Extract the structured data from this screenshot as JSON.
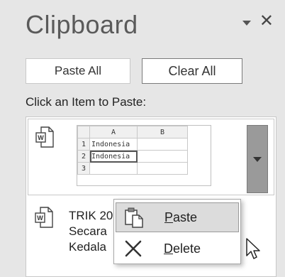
{
  "pane": {
    "title": "Clipboard",
    "options_icon": "dropdown-triangle-icon",
    "close_icon": "close-icon"
  },
  "buttons": {
    "paste_all": "Paste All",
    "clear_all": "Clear All"
  },
  "instruction": "Click an Item to Paste:",
  "items": [
    {
      "icon": "word-document-icon",
      "thumbnail": {
        "col_headers": [
          "A",
          "B"
        ],
        "rows": [
          {
            "num": "1",
            "a": "Indonesia",
            "b": ""
          },
          {
            "num": "2",
            "a": "Indonesia",
            "b": ""
          },
          {
            "num": "3",
            "a": "",
            "b": ""
          }
        ]
      },
      "dropdown_icon": "dropdown-triangle-icon"
    },
    {
      "icon": "word-document-icon",
      "text": "TRIK 20\nSecara\nKedala"
    }
  ],
  "context_menu": {
    "paste": {
      "underline": "P",
      "rest": "aste",
      "icon": "paste-icon"
    },
    "delete": {
      "underline": "D",
      "rest": "elete",
      "icon": "delete-x-icon"
    }
  },
  "colors": {
    "pane_bg": "#e6e6e6",
    "dropdown_bg": "#9a9a9a",
    "menu_highlight": "#dcdcdc"
  }
}
